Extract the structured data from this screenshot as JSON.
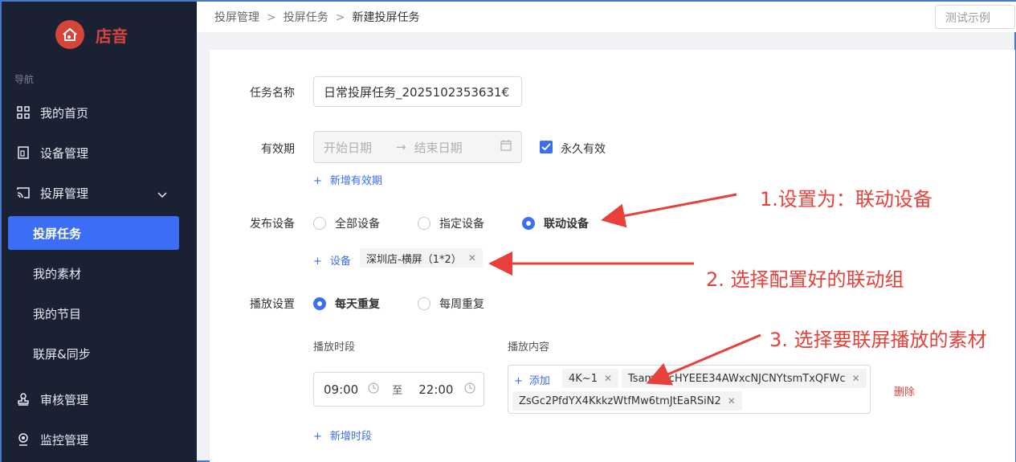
{
  "brand": {
    "name": "店音"
  },
  "nav": {
    "title": "导航",
    "items": [
      {
        "label": "我的首页"
      },
      {
        "label": "设备管理"
      },
      {
        "label": "投屏管理"
      },
      {
        "label": "投屏任务"
      },
      {
        "label": "我的素材"
      },
      {
        "label": "我的节目"
      },
      {
        "label": "联屏&同步"
      },
      {
        "label": "审核管理"
      },
      {
        "label": "监控管理"
      }
    ]
  },
  "breadcrumb": [
    "投屏管理",
    "投屏任务",
    "新建投屏任务"
  ],
  "breadcrumb_sep": ">",
  "header": {
    "test_label": "测试示例"
  },
  "form": {
    "task_name_label": "任务名称",
    "task_name_value": "日常投屏任务_2025102353631€",
    "validity_label": "有效期",
    "start_placeholder": "开始日期",
    "range_arrow": "→",
    "end_placeholder": "结束日期",
    "forever_label": "永久有效",
    "add_validity": "新增有效期",
    "publish_label": "发布设备",
    "publish_options": [
      "全部设备",
      "指定设备",
      "联动设备"
    ],
    "add_device": "设备",
    "device_tag": "深圳店-横屏（1*2）",
    "play_label": "播放设置",
    "play_options": [
      "每天重复",
      "每周重复"
    ],
    "period_header": "播放时段",
    "content_header": "播放内容",
    "start_time": "09:00",
    "to_label": "至",
    "end_time": "22:00",
    "add_content": "添加",
    "content_tags": [
      "4K~1",
      "TsamNPcHYEEE34AWxcNJCNYtsmTxQFWc",
      "ZsGc2PfdYX4KkkzWtfMw6tmJtEaRSiN2"
    ],
    "delete_label": "删除",
    "add_period": "新增时段",
    "plus": "+"
  },
  "annotations": [
    "1.设置为：联动设备",
    "2. 选择配置好的联动组",
    "3. 选择要联屏播放的素材"
  ],
  "colors": {
    "sidebar_bg": "#1a2133",
    "accent": "#3b6ef5",
    "brand": "#d6453a",
    "annotation": "#e8403a"
  }
}
